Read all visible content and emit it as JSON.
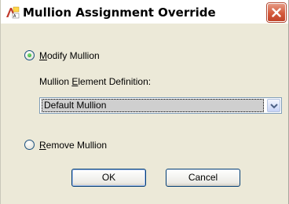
{
  "window": {
    "title": "Mullion Assignment Override",
    "icon": "autocad-architecture-icon",
    "close_icon": "close-icon"
  },
  "options": {
    "modify_mullion": {
      "prefix": "",
      "mnemonic": "M",
      "rest": "odify Mullion",
      "selected": true
    },
    "remove_mullion": {
      "prefix": "",
      "mnemonic": "R",
      "rest": "emove Mullion",
      "selected": false
    }
  },
  "element_definition": {
    "label_prefix": "Mullion ",
    "label_mnemonic": "E",
    "label_rest": "lement Definition:",
    "selected_value": "Default Mullion",
    "dropdown_icon": "chevron-down-icon"
  },
  "buttons": {
    "ok_label": "OK",
    "cancel_label": "Cancel"
  },
  "colors": {
    "dialog_bg": "#ece9d8",
    "close_red": "#d45a3c",
    "radio_green": "#21a121",
    "button_border": "#003c74"
  }
}
